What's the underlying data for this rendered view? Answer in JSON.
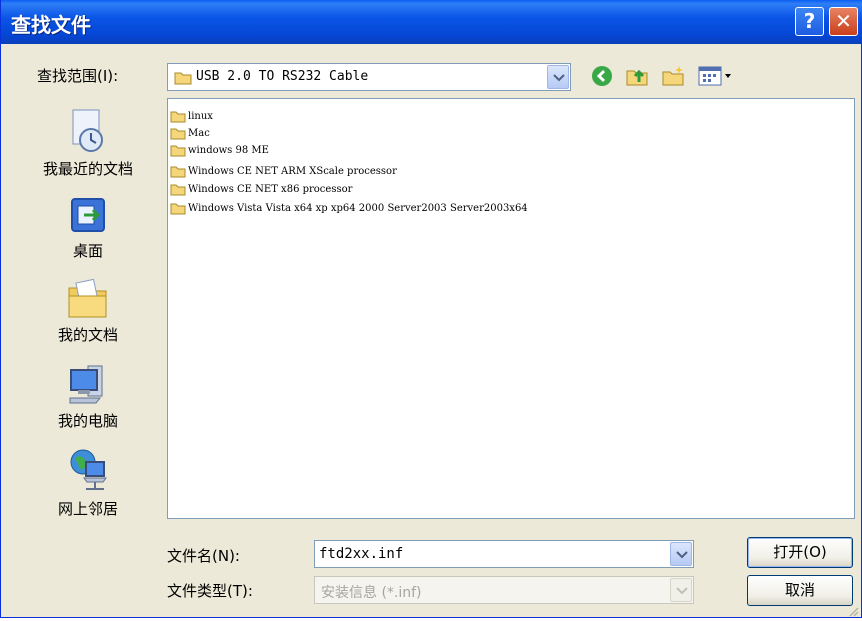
{
  "window": {
    "title": "查找文件"
  },
  "titlebar": {
    "help_label": "?",
    "close_label": "✕"
  },
  "lookin": {
    "label": "查找范围(I):",
    "value": "USB 2.0 TO RS232 Cable"
  },
  "places": [
    {
      "label": "我最近的文档",
      "icon": "recent-documents-icon"
    },
    {
      "label": "桌面",
      "icon": "desktop-icon"
    },
    {
      "label": "我的文档",
      "icon": "my-documents-icon"
    },
    {
      "label": "我的电脑",
      "icon": "my-computer-icon"
    },
    {
      "label": "网上邻居",
      "icon": "network-places-icon"
    }
  ],
  "files": [
    {
      "name": "linux",
      "icon": "folder-icon"
    },
    {
      "name": "Mac",
      "icon": "folder-icon"
    },
    {
      "name": "windows 98 ME",
      "icon": "folder-icon"
    },
    {
      "name": "Windows CE NET ARM XScale processor",
      "icon": "folder-icon"
    },
    {
      "name": "Windows CE NET x86 processor",
      "icon": "folder-icon"
    },
    {
      "name": "Windows Vista Vista x64 xp xp64 2000 Server2003 Server2003x64",
      "icon": "folder-icon"
    }
  ],
  "filename": {
    "label": "文件名(N):",
    "value": "ftd2xx.inf"
  },
  "filetype": {
    "label": "文件类型(T):",
    "value": "安装信息 (*.inf)"
  },
  "buttons": {
    "open": "打开(O)",
    "cancel": "取消"
  },
  "colors": {
    "titlebar": "#0a55e6",
    "dialog_bg": "#ece9d8",
    "folder": "#f5d67a",
    "field_border": "#7f9db9"
  }
}
